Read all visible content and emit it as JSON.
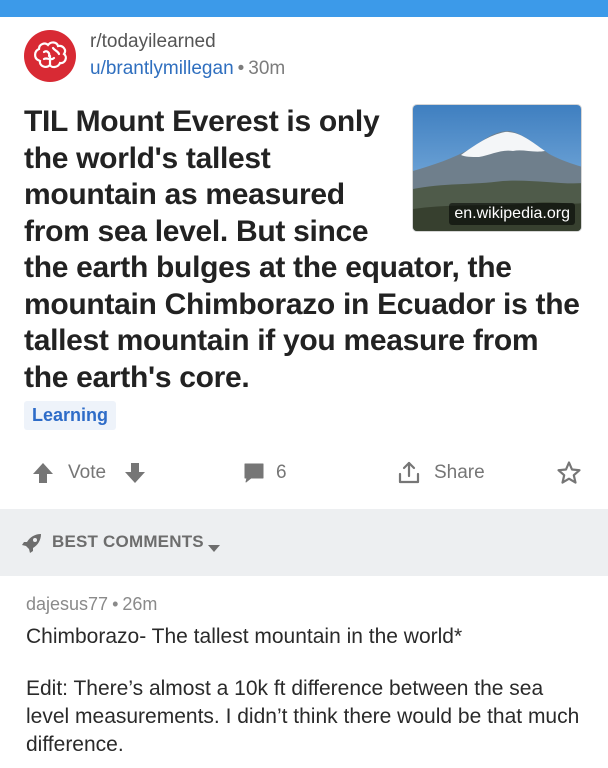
{
  "post": {
    "subreddit": "r/todayilearned",
    "author": "u/brantlymillegan",
    "separator": "•",
    "age": "30m",
    "title": "TIL Mount Everest is only the world's tallest mountain as measured from sea level. But since the earth bulges at the equator, the mountain Chimborazo in Ecuador is the tallest mountain if you measure from the earth's core.",
    "thumbnail_domain": "en.wikipedia.org",
    "flair": "Learning"
  },
  "actions": {
    "vote_label": "Vote",
    "comment_count": "6",
    "share_label": "Share"
  },
  "comments_section": {
    "sort_label": "BEST COMMENTS"
  },
  "comment": {
    "author": "dajesus77",
    "separator": "•",
    "age": "26m",
    "body_line1": "Chimborazo- The tallest mountain in the world*",
    "body_line2": "Edit: There’s almost a 10k ft difference between the sea level measurements. I didn’t think there would be that much difference."
  },
  "colors": {
    "topbar": "#3c9ae9",
    "subreddit_icon": "#d82a34",
    "author_link": "#2f6fbf",
    "flair_text": "#2e6cc8",
    "section_band": "#edeff1"
  },
  "icons": [
    "subreddit-brain-icon",
    "upvote-arrow-icon",
    "downvote-arrow-icon",
    "comment-bubble-icon",
    "share-icon",
    "save-star-icon",
    "rocket-icon",
    "caret-down-icon"
  ]
}
